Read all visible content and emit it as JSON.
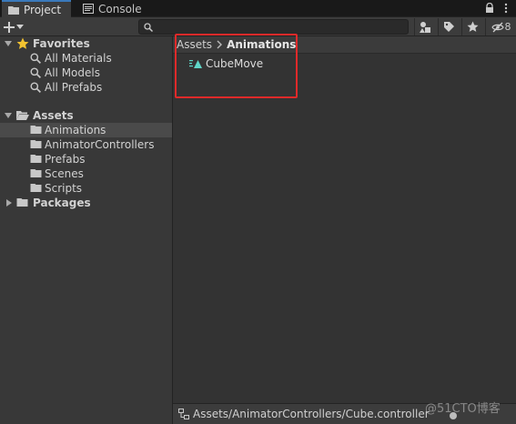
{
  "tabs": [
    {
      "label": "Project",
      "icon": "folder-icon",
      "active": true
    },
    {
      "label": "Console",
      "icon": "console-icon",
      "active": false
    }
  ],
  "toolbar": {
    "create_icon": "plus-icon",
    "search_placeholder": "",
    "hidden_count": "8"
  },
  "favorites": {
    "label": "Favorites",
    "items": [
      "All Materials",
      "All Models",
      "All Prefabs"
    ]
  },
  "assets": {
    "label": "Assets",
    "folders": [
      "Animations",
      "AnimatorControllers",
      "Prefabs",
      "Scenes",
      "Scripts"
    ],
    "selected": "Animations"
  },
  "packages": {
    "label": "Packages"
  },
  "breadcrumb": {
    "root": "Assets",
    "current": "Animations"
  },
  "content": {
    "items": [
      {
        "name": "CubeMove",
        "icon": "animation-clip-icon"
      }
    ]
  },
  "statusbar": {
    "path": "Assets/AnimatorControllers/Cube.controller"
  },
  "watermark": "@51CTO博客",
  "colors": {
    "selection_outline": "#e02a2a",
    "active_tab_accent": "#3a79bb",
    "favorites_star": "#f2c230",
    "clip_icon": "#5fd6c8"
  }
}
